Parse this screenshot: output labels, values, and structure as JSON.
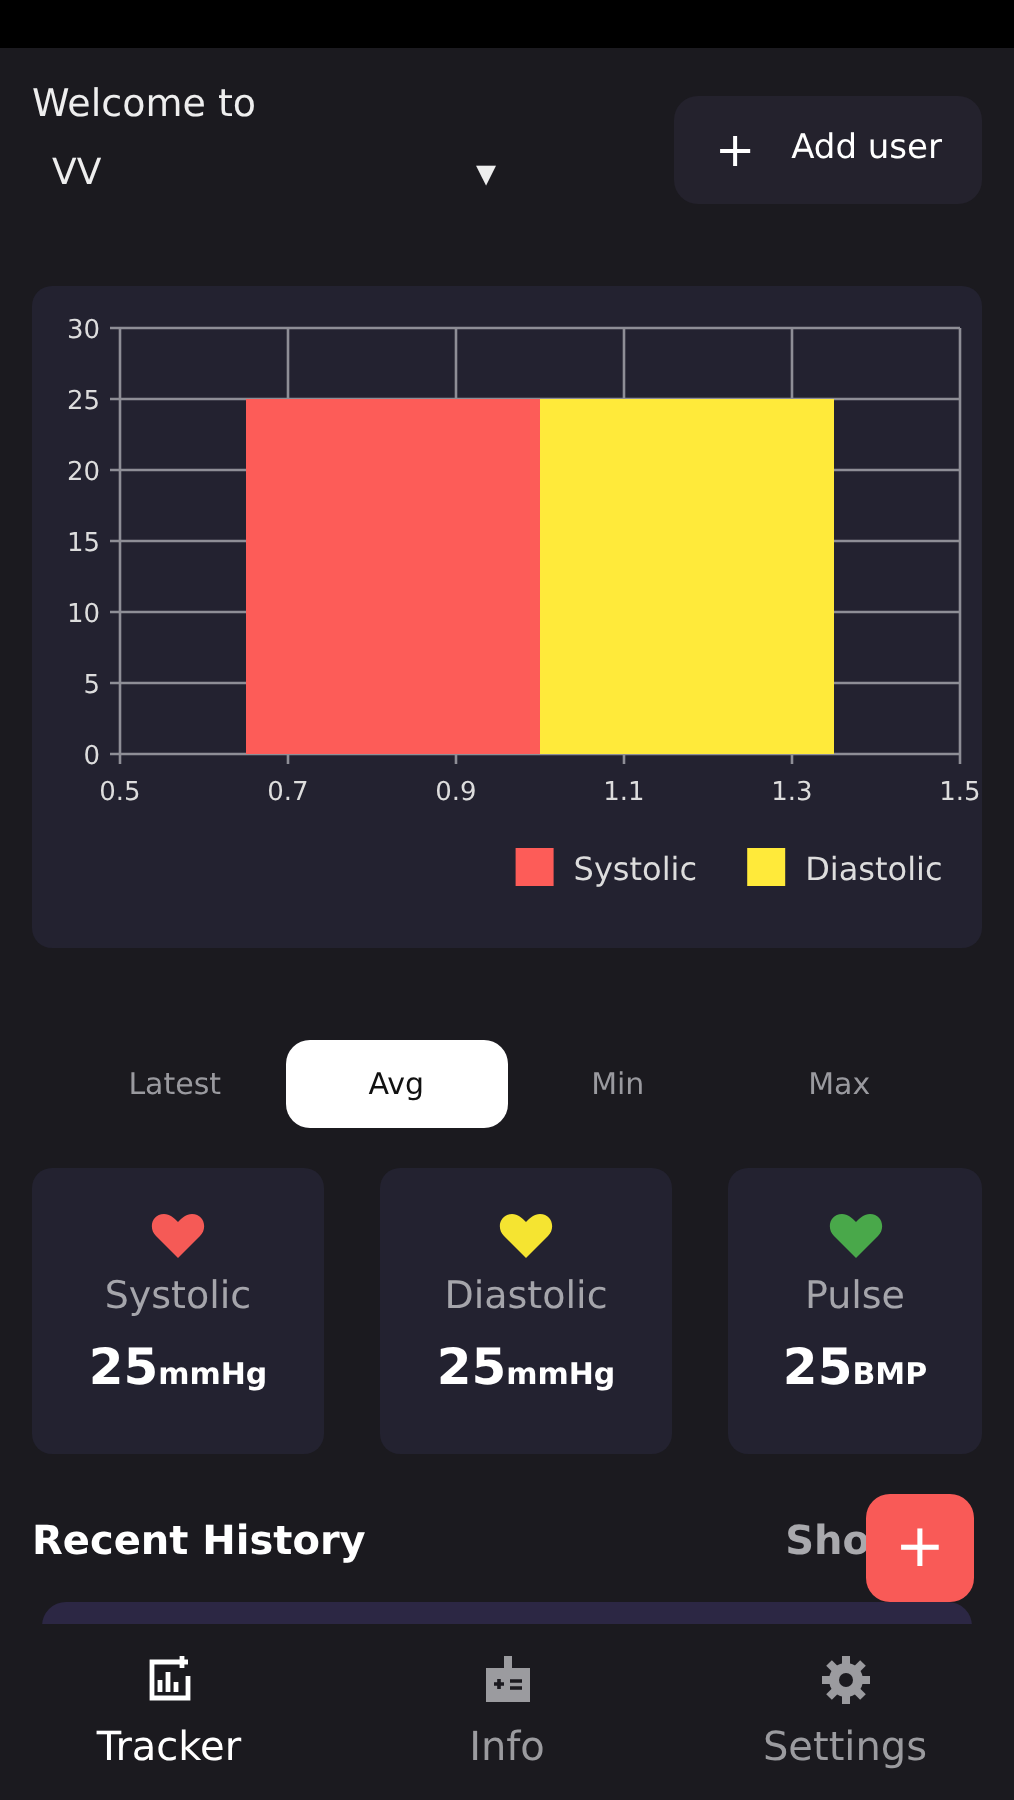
{
  "header": {
    "greeting": "Welcome to",
    "user_select": {
      "value": "VV",
      "caret": "▾"
    },
    "add_user_button": {
      "icon": "+",
      "label": "Add user"
    }
  },
  "chart": {
    "chart_data": {
      "type": "bar",
      "grid": true,
      "legend": "bottom",
      "x": [
        0.825,
        1.175
      ],
      "xlim": [
        0.5,
        1.5
      ],
      "ylim": [
        0,
        30
      ],
      "xticks": [
        {
          "value": 0.5,
          "label": "0.5"
        },
        {
          "value": 0.7,
          "label": "0.7"
        },
        {
          "value": 0.9,
          "label": "0.9"
        },
        {
          "value": 1.1,
          "label": "1.1"
        },
        {
          "value": 1.3,
          "label": "1.3"
        },
        {
          "value": 1.5,
          "label": "1.5"
        }
      ],
      "yticks": [
        0,
        5,
        10,
        15,
        20,
        25,
        30
      ],
      "series": [
        {
          "name": "Systolic",
          "color": "#fd5c58",
          "values": [
            25,
            null
          ]
        },
        {
          "name": "Diastolic",
          "color": "#ffea3a",
          "values": [
            null,
            25
          ]
        }
      ]
    }
  },
  "tabs": [
    {
      "label": "Latest",
      "selected": false
    },
    {
      "label": "Avg",
      "selected": true
    },
    {
      "label": "Min",
      "selected": false
    },
    {
      "label": "Max",
      "selected": false
    }
  ],
  "stats": [
    {
      "label": "Systolic",
      "value": "25",
      "unit": "mmHg",
      "color": "#f55a56"
    },
    {
      "label": "Diastolic",
      "value": "25",
      "unit": "mmHg",
      "color": "#f5e431"
    },
    {
      "label": "Pulse",
      "value": "25",
      "unit": "BMP",
      "color": "#49a84a"
    }
  ],
  "recent_history": {
    "title": "Recent History",
    "link": "Sho"
  },
  "fab": {
    "icon": "+"
  },
  "bottom_nav": [
    {
      "label": "Tracker",
      "selected": true
    },
    {
      "label": "Info",
      "selected": false
    },
    {
      "label": "Settings",
      "selected": false
    }
  ]
}
